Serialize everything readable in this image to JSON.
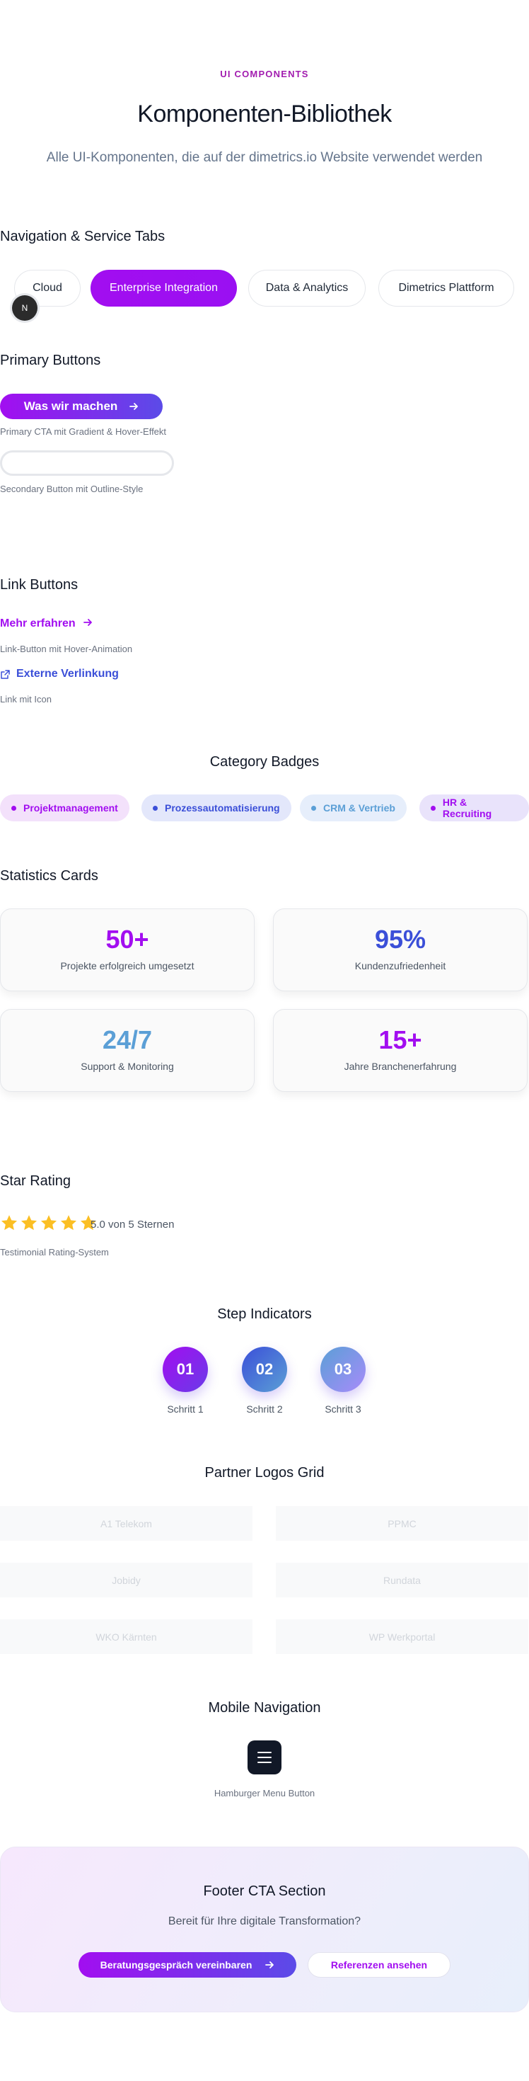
{
  "header": {
    "eyebrow": "UI COMPONENTS",
    "title": "Komponenten-Bibliothek",
    "subtitle": "Alle UI-Komponenten, die auf der dimetrics.io Website verwendet werden"
  },
  "nav_tabs": {
    "title": "Navigation & Service Tabs",
    "tabs": [
      "Cloud",
      "Enterprise Integration",
      "Data & Analytics",
      "Dimetrics Plattform"
    ],
    "active_tab": "Enterprise Integration",
    "badge_letter": "N"
  },
  "primary_buttons": {
    "title": "Primary Buttons",
    "primary_label": "Was wir machen",
    "primary_caption": "Primary CTA mit Gradient & Hover-Effekt",
    "secondary_label": "",
    "secondary_caption": "Secondary Button mit Outline-Style"
  },
  "link_buttons": {
    "title": "Link Buttons",
    "link1_label": "Mehr erfahren",
    "link1_caption": "Link-Button mit Hover-Animation",
    "link2_label": "Externe Verlinkung",
    "link2_caption": "Link mit Icon"
  },
  "badges": {
    "title": "Category Badges",
    "items": [
      {
        "label": "Projektmanagement",
        "color": "#a20ef0",
        "bg": "#f3e1fb"
      },
      {
        "label": "Prozessautomatisierung",
        "color": "#3b4fd8",
        "bg": "#e3e7fb"
      },
      {
        "label": "CRM & Vertrieb",
        "color": "#5b9fd6",
        "bg": "#e6eefb"
      },
      {
        "label": "HR & Recruiting",
        "color": "#a20ef0",
        "bg": "#e9e3fb"
      }
    ]
  },
  "stats": {
    "title": "Statistics Cards",
    "cards": [
      {
        "value": "50+",
        "label": "Projekte erfolgreich umgesetzt",
        "color": "#a20ef0"
      },
      {
        "value": "95%",
        "label": "Kundenzufriedenheit",
        "color": "#3b4fd8"
      },
      {
        "value": "24/7",
        "label": "Support & Monitoring",
        "color": "#5b9fd6"
      },
      {
        "value": "15+",
        "label": "Jahre Branchenerfahrung",
        "color": "#a20ef0"
      }
    ]
  },
  "rating": {
    "title": "Star Rating",
    "stars": 5,
    "text": "5.0 von 5 Sternen",
    "caption": "Testimonial Rating-System",
    "star_color": "#fbbf24"
  },
  "steps": {
    "title": "Step Indicators",
    "items": [
      {
        "number": "01",
        "label": "Schritt 1"
      },
      {
        "number": "02",
        "label": "Schritt 2"
      },
      {
        "number": "03",
        "label": "Schritt 3"
      }
    ]
  },
  "partners": {
    "title": "Partner Logos Grid",
    "logos": [
      "A1 Telekom",
      "PPMC",
      "Jobidy",
      "Rundata",
      "WKO Kärnten",
      "WP Werkportal"
    ]
  },
  "mobile_nav": {
    "title": "Mobile Navigation",
    "caption": "Hamburger Menu Button"
  },
  "footer_cta": {
    "title": "Footer CTA Section",
    "subtitle": "Bereit für Ihre digitale Transformation?",
    "primary_label": "Beratungsgespräch vereinbaren",
    "secondary_label": "Referenzen ansehen"
  },
  "colors": {
    "accent_purple": "#a20ef0",
    "accent_blue": "#3b4fd8",
    "accent_light_blue": "#5b9fd6"
  }
}
